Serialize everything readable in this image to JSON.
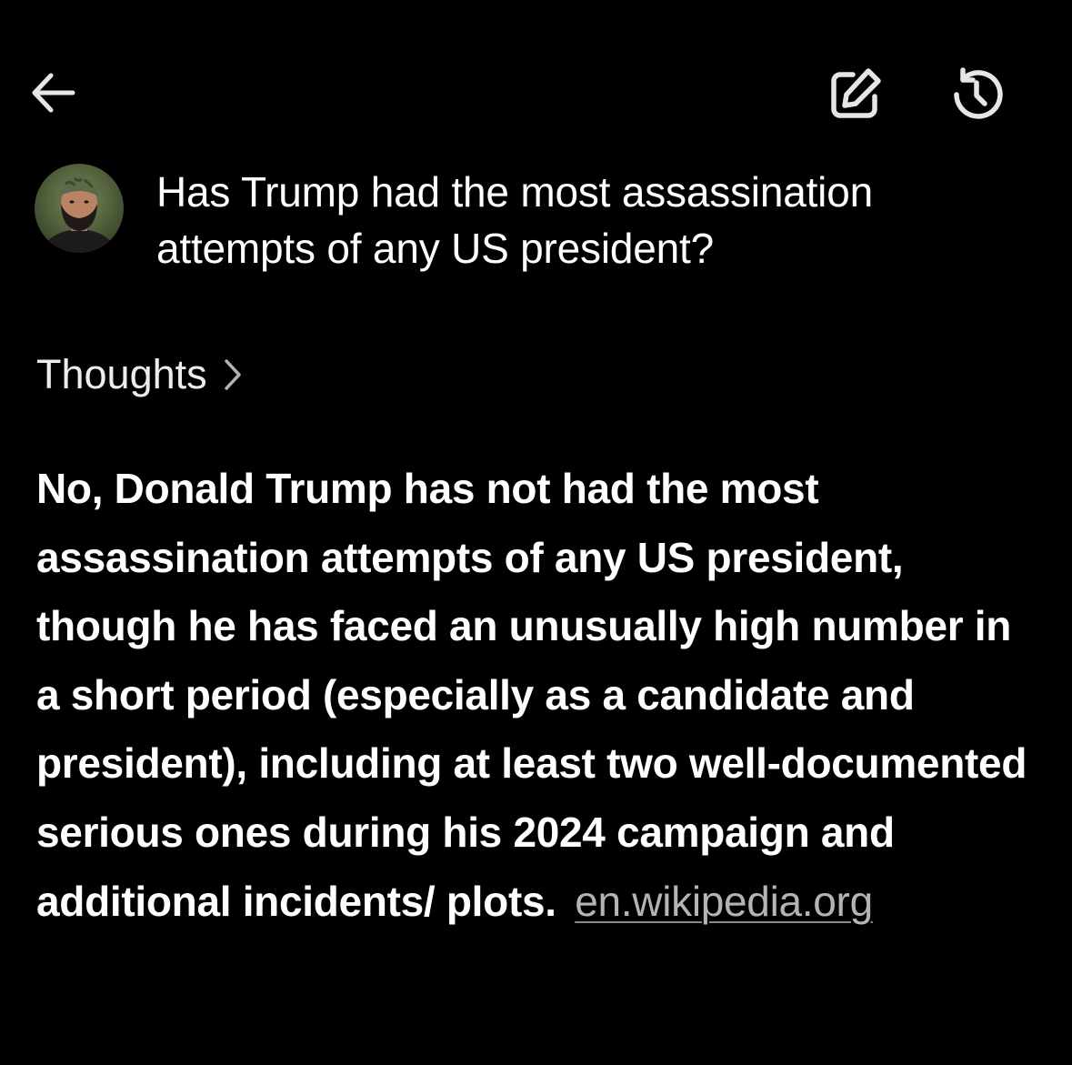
{
  "header": {
    "back_icon": "arrow-left-icon",
    "edit_icon": "edit-square-pencil-icon",
    "history_icon": "history-clock-icon"
  },
  "query": {
    "avatar_icon": "user-avatar",
    "text": "Has Trump had the most assassination attempts of any US president?"
  },
  "thoughts": {
    "label": "Thoughts",
    "chevron_icon": "chevron-right-icon"
  },
  "answer": {
    "text": "No, Donald Trump has not had the most assassination attempts of any US president, though he has faced an unusually high number in a short period (especially as a candidate and president), including at least two well-documented serious ones during his 2024 campaign and additional incidents/ plots.",
    "source_label": "en.wikipedia.org"
  },
  "colors": {
    "background": "#000000",
    "text": "#ffffff",
    "link": "#b4b4b4"
  }
}
